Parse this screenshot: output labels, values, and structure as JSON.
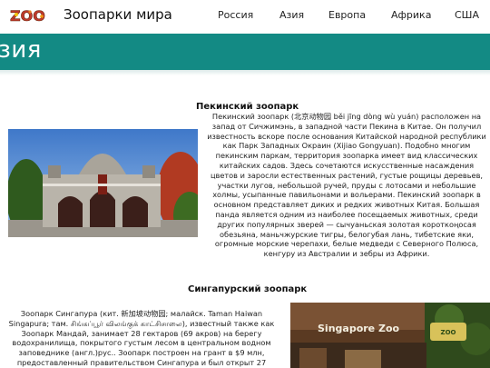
{
  "header": {
    "logo_text": "ZOO",
    "site_title": "Зоопарки мира",
    "nav": [
      {
        "label": "Россия"
      },
      {
        "label": "Азия"
      },
      {
        "label": "Европа"
      },
      {
        "label": "Африка"
      },
      {
        "label": "США"
      }
    ]
  },
  "banner": {
    "title": "зия",
    "color": "#138a84"
  },
  "sections": [
    {
      "heading": "Пекинский зоопарк",
      "text": "Пекинский зоопарк (北京动物园 běi jīng dòng wù yuán) расположен на запад от Сичжимэнь, в западной части Пекина в Китае. Он получил известность вскоре после основания Китайской народной республики как Парк Западных Окраин (Xijiao Gongyuan). Подобно многим пекинским паркам, территория зоопарка имеет вид классических китайских садов. Здесь сочетаются искусственные насаждения цветов и заросли естественных растений, густые рощицы деревьев, участки лугов, небольшой ручей, пруды с лотосами и небольшие холмы, усыпанные павильонами и вольерами. Пекинский зоопарк в основном представляет диких и редких животных Китая. Большая панда является одним из наиболее посещаемых животных, среди других популярных зверей — сычуаньская золотая короткоңосая обезьяна, маньчжурские тигры, белогубая лань, тибетские яки, огромные морские черепахи, белые медведи с Северного Полюса, кенгуру из Австралии и зебры из Африки.",
      "image_icon": "zoo-gate-photo"
    },
    {
      "heading": "Сингапурский зоопарк",
      "text": "Зоопарк Сингапура (кит. 新加坡动物园; малайск. Taman Haiwan Singapura; там. சிங்கப்பூர் விலங்குக் காட்சிசாலை), известный также как Зоопарк Мандай, занимает 28 гектаров (69 акров) на берегу водохранилища, покрытого густым лесом в центральном водном заповеднике (англ.)рус.. Зоопарк построен на грант в $9 млн, предоставленный правительством Сингапура и был открыт 27",
      "image_text": "Singapore Zoo",
      "image_icon": "singapore-zoo-entrance-photo"
    }
  ]
}
